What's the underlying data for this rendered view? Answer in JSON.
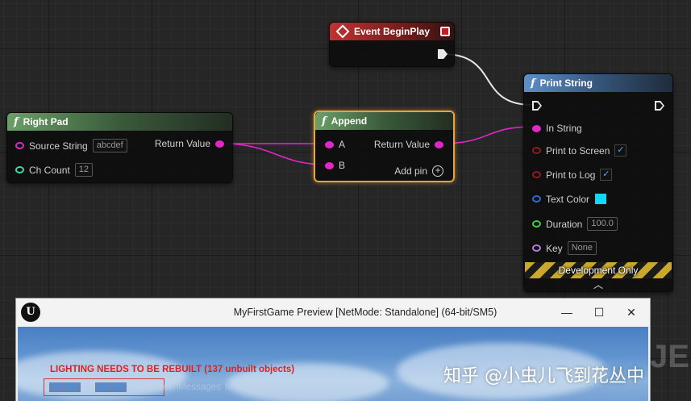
{
  "nodes": {
    "event_begin_play": {
      "title": "Event BeginPlay"
    },
    "right_pad": {
      "glyph": "f",
      "title": "Right Pad",
      "source_string_label": "Source String",
      "source_string_value": "abcdef",
      "ch_count_label": "Ch Count",
      "ch_count_value": "12",
      "return_value_label": "Return Value"
    },
    "append": {
      "glyph": "f",
      "title": "Append",
      "pin_a": "A",
      "pin_b": "B",
      "return_value_label": "Return Value",
      "add_pin_label": "Add pin"
    },
    "print_string": {
      "glyph": "f",
      "title": "Print String",
      "in_string_label": "In String",
      "print_to_screen_label": "Print to Screen",
      "print_to_screen_checked": true,
      "print_to_log_label": "Print to Log",
      "print_to_log_checked": true,
      "text_color_label": "Text Color",
      "text_color_value": "#14d7f5",
      "duration_label": "Duration",
      "duration_value": "100.0",
      "key_label": "Key",
      "key_value": "None",
      "dev_only_label": "Development Only"
    }
  },
  "preview_window": {
    "title": "MyFirstGame Preview [NetMode: Standalone]  (64-bit/SM5)",
    "logo": "U",
    "minimize": "—",
    "maximize": "☐",
    "close": "✕",
    "rebuild_warning": "LIGHTING NEEDS TO BE REBUILT (137 unbuilt objects)",
    "message_1": "abcdef",
    "message_2": "abcdef",
    "suppress_hint": "AllScreenMessages' to suppress"
  },
  "watermark": "知乎 @小虫儿飞到花丛中",
  "corner_fragment": "JE",
  "colors": {
    "string_pin": "#e028c8",
    "int_pin": "#3fd7a9",
    "exec_wire": "#e8e8e8",
    "selection": "#e8a33a"
  }
}
